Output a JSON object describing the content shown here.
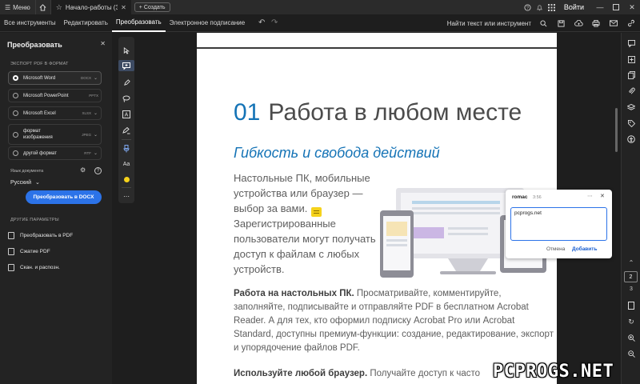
{
  "titlebar": {
    "menu_label": "Меню",
    "tab_title": "Начало-работы (ЗА...",
    "create_label": "Создать",
    "login_label": "Войти"
  },
  "toolbar": {
    "tabs": [
      {
        "label": "Все инструменты"
      },
      {
        "label": "Редактировать"
      },
      {
        "label": "Преобразовать"
      },
      {
        "label": "Электронное подписание"
      }
    ],
    "active_tab": "Преобразовать",
    "search_label": "Найти текст или инструмент"
  },
  "left_panel": {
    "title": "Преобразовать",
    "export_section": "ЭКСПОРТ PDF В ФОРМАТ",
    "options": [
      {
        "label": "Microsoft Word",
        "format": "DOCX",
        "selected": true
      },
      {
        "label": "Microsoft PowerPoint",
        "format": "PPTX",
        "selected": false
      },
      {
        "label": "Microsoft Excel",
        "format": "XLSX",
        "selected": false
      },
      {
        "label": "формат изображения",
        "format": "JPEG",
        "selected": false
      },
      {
        "label": "другой формат",
        "format": "RTF",
        "selected": false
      }
    ],
    "language_label": "Язык документа",
    "language_value": "Русский",
    "convert_button": "Преобразовать в DOCX",
    "other_section": "ДРУГИЕ ПАРАМЕТРЫ",
    "other_options": [
      {
        "label": "Преобразовать в PDF"
      },
      {
        "label": "Сжатие PDF"
      },
      {
        "label": "Скан. и распозн."
      }
    ]
  },
  "document": {
    "heading_number": "01",
    "heading_text": "Работа в любом месте",
    "subheading": "Гибкость и свобода действий",
    "para1": "Настольные ПК, мобильные устройства или браузер — выбор за вами. Зарегистрированные пользователи могут получать доступ к файлам с любых устройств.",
    "para2_bold": "Работа на настольных ПК.",
    "para2_text": " Просматривайте, комментируйте, заполняйте, подписывайте и отправляйте PDF в бесплатном Acrobat Reader. А для тех, кто оформил подписку Acrobat Pro или Acrobat Standard, доступны премиум-функции: создание, редактирование, экспорт и упорядочение файлов PDF.",
    "para3_bold": "Используйте любой браузер.",
    "para3_text": " Получайте доступ к часто"
  },
  "comment": {
    "user": "romac",
    "time": "3:56",
    "text": "pcprogs.net",
    "cancel_label": "Отмена",
    "add_label": "Добавить"
  },
  "pagination": {
    "current_page": "2",
    "total_pages": "3"
  },
  "watermark": "PCPROGS.NET",
  "colors": {
    "accent": "#2c73e8",
    "heading_blue": "#1473b6",
    "note_yellow": "#f5d21c"
  }
}
